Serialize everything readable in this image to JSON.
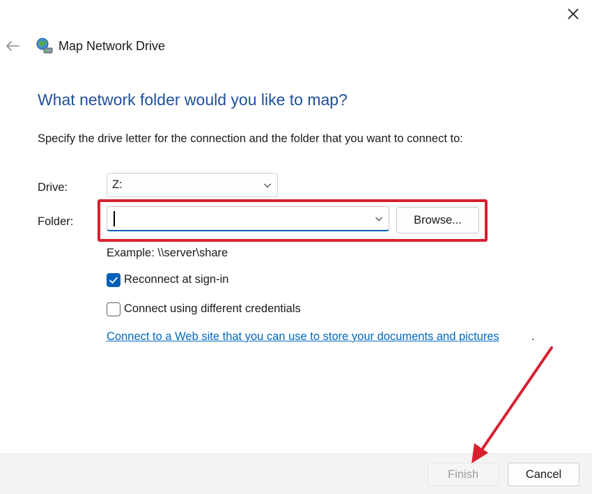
{
  "window": {
    "title": "Map Network Drive",
    "close_icon": "close-icon",
    "back_icon": "back-arrow-icon",
    "app_icon": "network-drive-icon"
  },
  "main": {
    "heading": "What network folder would you like to map?",
    "instructions": "Specify the drive letter for the connection and the folder that you want to connect to:",
    "drive": {
      "label": "Drive:",
      "value": "Z:"
    },
    "folder": {
      "label": "Folder:",
      "value": "",
      "browse_label": "Browse..."
    },
    "example": "Example: \\\\server\\share",
    "reconnect": {
      "label": "Reconnect at sign-in",
      "checked": true
    },
    "credentials": {
      "label": "Connect using different credentials",
      "checked": false
    },
    "web_link": "Connect to a Web site that you can use to store your documents and pictures",
    "web_link_suffix": "."
  },
  "footer": {
    "finish_label": "Finish",
    "finish_enabled": false,
    "cancel_label": "Cancel"
  },
  "colors": {
    "heading": "#1f4f9a",
    "accent": "#005fb8",
    "link": "#0067c0",
    "annotation": "#d8202f"
  }
}
